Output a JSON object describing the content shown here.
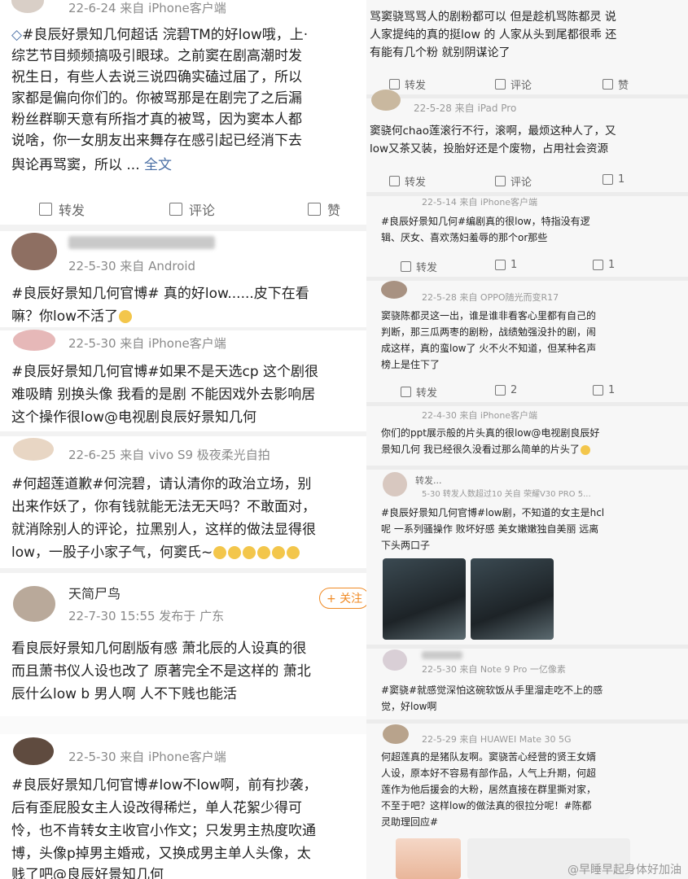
{
  "left": {
    "post1": {
      "meta": "22-6-24  来自 iPhone客户端",
      "lines": [
        "#良辰好景知几何超话 浣碧TM的好low哦，上·",
        "综艺节目频频搞吸引眼球。之前窦在剧高潮时发",
        "祝生日，有些人去说三说四确实磕过届了，所以",
        "家都是偏向你们的。你被骂那是在剧完了之后漏",
        "粉丝群聊天意有所指才真的被骂，因为窦本人都",
        "说啥，你一女朋友出来舞存在感引起已经消下去",
        "舆论再骂窦，所以 ..."
      ],
      "more": "全文",
      "actions": {
        "repost": "转发",
        "comment": "评论",
        "like": "赞"
      }
    },
    "post2": {
      "meta": "22-5-30  来自 Android",
      "lines": [
        "#良辰好景知几何官博# 真的好low......皮下在看",
        "嘛？你low不活了"
      ]
    },
    "post3": {
      "meta": "22-5-30  来自 iPhone客户端",
      "lines": [
        "#良辰好景知几何官博#如果不是天选cp 这个剧很",
        "难吸睛 别换头像 我看的是剧 不能因戏外去影响居",
        "这个操作很low@电视剧良辰好景知几何"
      ]
    },
    "post4": {
      "meta": "22-6-25  来自 vivo S9 极夜柔光自拍",
      "lines": [
        "#何超莲道歉#何浣碧，请认清你的政治立场，别",
        "出来作妖了，你有钱就能无法无天吗？不敢面对，",
        "就消除别人的评论，拉黑别人，这样的做法显得很",
        "low，一股子小家子气，何窦氏~"
      ]
    },
    "post5": {
      "name": "天简尸鸟",
      "follow": "+ 关注",
      "meta": "22-7-30 15:55  发布于 广东",
      "lines": [
        "看良辰好景知几何剧版有感 萧北辰的人设真的很",
        "而且萧书仪人设也改了 原著完全不是这样的 萧北",
        "辰什么low b 男人啊 人不下贱也能活"
      ]
    },
    "post6": {
      "meta": "22-5-30  来自 iPhone客户端",
      "lines": [
        "#良辰好景知几何官博#low不low啊，前有抄袭，",
        "后有歪屁股女主人设改得稀烂，单人花絮少得可",
        "怜，也不肯转女主收官小作文；只发男主热度吹通",
        "博，头像p掉男主婚戒，又换成男主单人头像，太",
        "贱了吧@良辰好景知几何"
      ]
    }
  },
  "right": {
    "r1": {
      "lines": [
        "骂窦骁骂骂人的剧粉都可以 但是趁机骂陈都灵 说",
        "人家提纯的真的挺low 的 人家从头到尾都很乖 还",
        "有能有几个粉 就别阴谋论了"
      ],
      "actions": {
        "repost": "转发",
        "comment": "评论",
        "like": "赞"
      }
    },
    "r2": {
      "meta": "22-5-28  来自 iPad Pro",
      "lines": [
        "窦骁何chao莲滚行不行，滚啊，最烦这种人了，又",
        "low又茶又装，投胎好还是个废物，占用社会资源"
      ],
      "actions": {
        "repost": "转发",
        "comment": "评论",
        "like": "1"
      }
    },
    "r3": {
      "meta": "22-5-14  来自 iPhone客户端",
      "lines": [
        "#良辰好景知几何#编剧真的很low，特指没有逻",
        "辑、厌女、喜欢荡妇羞辱的那个or那些"
      ],
      "actions": {
        "repost": "转发",
        "comment": "1",
        "like": "1"
      }
    },
    "r4": {
      "meta": "22-5-28  来自 OPPO随光而变R17",
      "lines": [
        "窦骁陈都灵这一出，谁是谁非看客心里都有自己的",
        "判断，那三瓜两枣的剧粉，战绩勉强没扑的剧，闹",
        "成这样，真的蛮low了 火不火不知道，但某种名声",
        "榜上是住下了"
      ],
      "actions": {
        "repost": "转发",
        "comment": "2",
        "like": "1"
      }
    },
    "r5": {
      "meta": "22-4-30  来自 iPhone客户端",
      "lines": [
        "你们的ppt展示般的片头真的很low@电视剧良辰好",
        "景知几何 我已经很久没看过那么简单的片头了"
      ]
    },
    "r6": {
      "name": "转发...",
      "meta": "5-30 转发人数超过10  关自 荣耀V30 PRO 5...",
      "lines": [
        "#良辰好景知几何官博#low剧，不知道的女主是hcl",
        "呢 一系列骚操作 败坏好感 美女嫩嫩独自美丽 远离",
        "下头两口子"
      ]
    },
    "r7": {
      "meta": "22-5-30  来自 Note 9 Pro 一亿像素",
      "lines": [
        "#窦骁#就感觉深怕这碗软饭从手里溜走吃不上的感",
        "觉，好low啊"
      ]
    },
    "r8": {
      "meta": "22-5-29  来自 HUAWEI Mate 30 5G",
      "lines": [
        "何超莲真的是猪队友啊。窦骁苦心经营的贤王女婿",
        "人设，原本好不容易有部作品，人气上升期，何超",
        "莲作为他后援会的大粉，居然直接在群里撕对家，",
        "不至于吧？这样low的做法真的很拉分呢！#陈都",
        "灵助理回应#"
      ]
    },
    "watermark": "@早睡早起身体好加油"
  }
}
